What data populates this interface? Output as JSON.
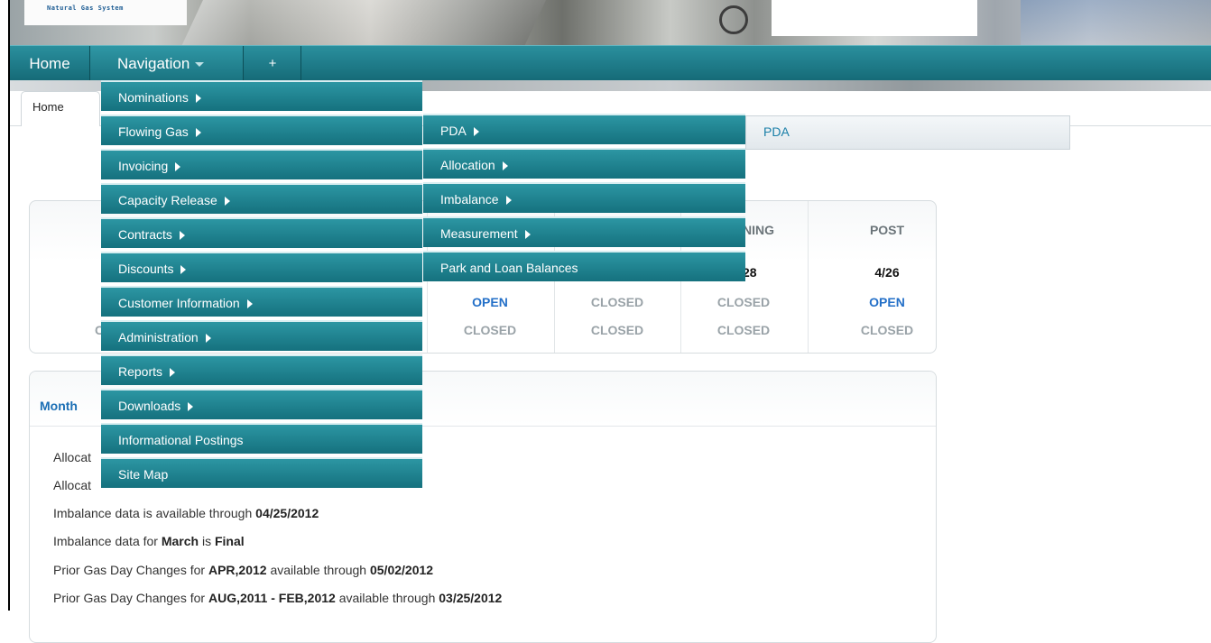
{
  "banner": {
    "logo_text": "Natural Gas System"
  },
  "navbar": {
    "home": "Home",
    "navigation": "Navigation",
    "plus": "+"
  },
  "tabs": {
    "home": "Home",
    "pda": "PDA"
  },
  "menu": {
    "items": [
      {
        "label": "Nominations",
        "submenu": true
      },
      {
        "label": "Flowing Gas",
        "submenu": true
      },
      {
        "label": "Invoicing",
        "submenu": true
      },
      {
        "label": "Capacity Release",
        "submenu": true
      },
      {
        "label": "Contracts",
        "submenu": true
      },
      {
        "label": "Discounts",
        "submenu": true
      },
      {
        "label": "Customer Information",
        "submenu": true
      },
      {
        "label": "Administration",
        "submenu": true
      },
      {
        "label": "Reports",
        "submenu": true
      },
      {
        "label": "Downloads",
        "submenu": true
      },
      {
        "label": "Informational Postings",
        "submenu": false
      },
      {
        "label": "Site Map",
        "submenu": false
      }
    ]
  },
  "submenu": {
    "items": [
      {
        "label": "PDA",
        "submenu": true
      },
      {
        "label": "Allocation",
        "submenu": true
      },
      {
        "label": "Imbalance",
        "submenu": true
      },
      {
        "label": "Measurement",
        "submenu": true
      },
      {
        "label": "Park and Loan Balances",
        "submenu": false
      }
    ]
  },
  "status": {
    "partial_header": "NING",
    "post_header": "POST",
    "partial_date": "28",
    "post_date": "4/26",
    "row1": [
      "OPEN",
      "CLOSED",
      "CLOSED",
      "OPEN"
    ],
    "row2": [
      "CLOSED",
      "CLOSED",
      "CLOSED",
      "CLOSED"
    ],
    "left_fragment": "C"
  },
  "month": {
    "title_fragment": "Month",
    "alloc_fragment_1": "Allocat",
    "alloc_fragment_2": "Allocat",
    "lines": [
      {
        "pre": "Imbalance data is available through ",
        "bold": "04/25/2012",
        "mid": "",
        "bold2": "",
        "post": ""
      },
      {
        "pre": "Imbalance data for ",
        "bold": "March",
        "mid": " is ",
        "bold2": "Final",
        "post": ""
      },
      {
        "pre": "Prior Gas Day Changes for ",
        "bold": "APR,2012",
        "mid": " available through ",
        "bold2": "05/02/2012",
        "post": ""
      },
      {
        "pre": "Prior Gas Day Changes for ",
        "bold": "AUG,2011 - FEB,2012",
        "mid": " available through ",
        "bold2": "03/25/2012",
        "post": ""
      }
    ]
  }
}
